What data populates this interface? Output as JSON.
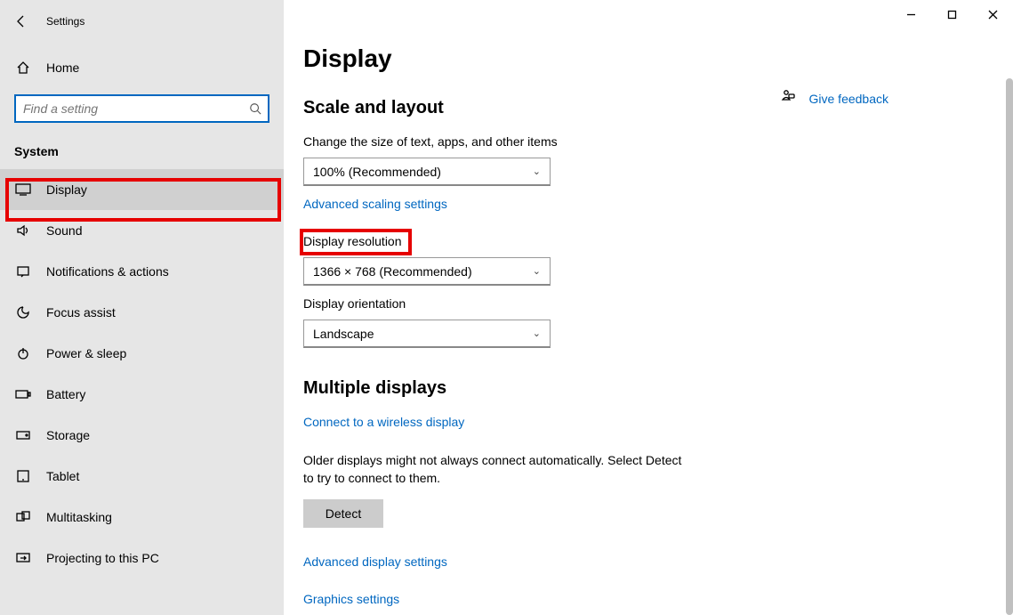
{
  "app_title": "Settings",
  "home_label": "Home",
  "search_placeholder": "Find a setting",
  "section_header": "System",
  "nav": {
    "display": "Display",
    "sound": "Sound",
    "notifications": "Notifications & actions",
    "focus": "Focus assist",
    "power": "Power & sleep",
    "battery": "Battery",
    "storage": "Storage",
    "tablet": "Tablet",
    "multitask": "Multitasking",
    "projecting": "Projecting to this PC"
  },
  "main": {
    "title": "Display",
    "scale_heading": "Scale and layout",
    "scale_label": "Change the size of text, apps, and other items",
    "scale_value": "100% (Recommended)",
    "adv_scaling_link": "Advanced scaling settings",
    "resolution_label": "Display resolution",
    "resolution_value": "1366 × 768 (Recommended)",
    "orientation_label": "Display orientation",
    "orientation_value": "Landscape",
    "multiple_heading": "Multiple displays",
    "wireless_link": "Connect to a wireless display",
    "detect_hint": "Older displays might not always connect automatically. Select Detect to try to connect to them.",
    "detect_btn": "Detect",
    "adv_display_link": "Advanced display settings",
    "graphics_link": "Graphics settings"
  },
  "feedback_label": "Give feedback"
}
